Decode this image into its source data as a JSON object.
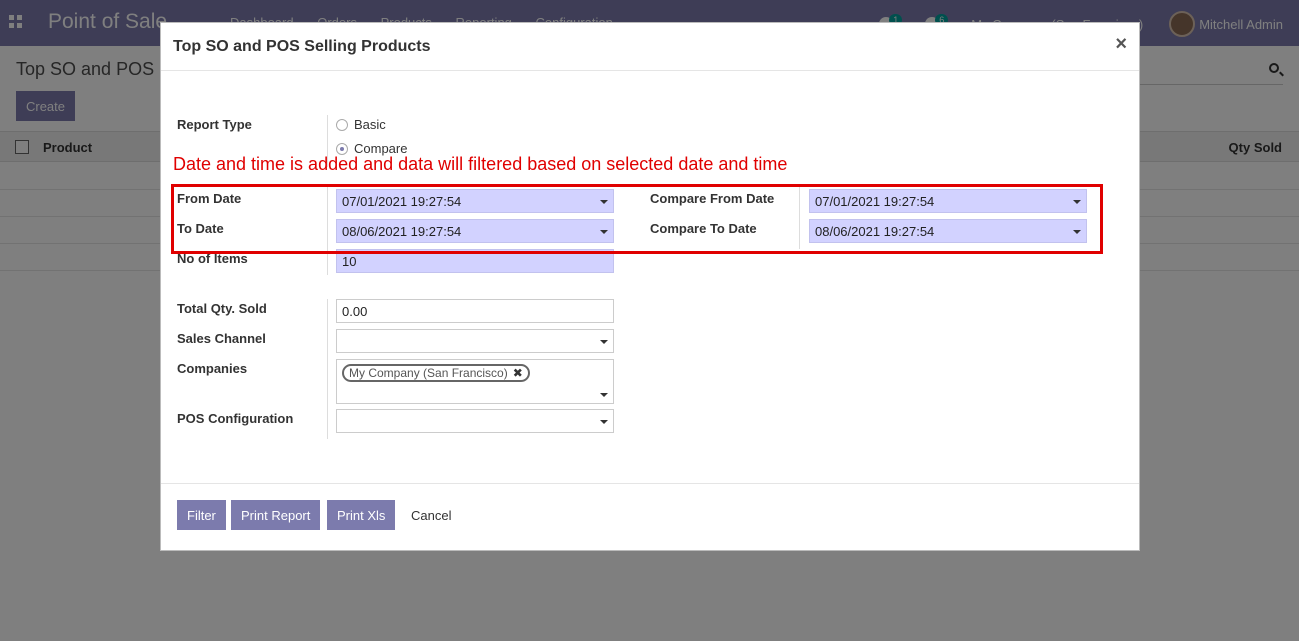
{
  "navbar": {
    "brand": "Point of Sale",
    "menu": [
      "Dashboard",
      "Orders",
      "Products",
      "Reporting",
      "Configuration"
    ],
    "activity_count": "1",
    "messages_count": "6",
    "company": "My Company (San Francisco)",
    "user": "Mitchell Admin"
  },
  "control_panel": {
    "title": "Top SO and POS Selling Products",
    "create_label": "Create"
  },
  "list": {
    "columns": [
      "Product",
      "Qty Sold"
    ]
  },
  "modal": {
    "title": "Top SO and POS Selling Products",
    "close_glyph": "×",
    "annotation": "Date and time is added and data will filtered based on selected date and time",
    "fields": {
      "report_type": {
        "label": "Report Type",
        "options": [
          "Basic",
          "Compare"
        ],
        "selected": "Compare"
      },
      "from_date": {
        "label": "From Date",
        "value": "07/01/2021 19:27:54"
      },
      "to_date": {
        "label": "To Date",
        "value": "08/06/2021 19:27:54"
      },
      "compare_from_date": {
        "label": "Compare From Date",
        "value": "07/01/2021 19:27:54"
      },
      "compare_to_date": {
        "label": "Compare To Date",
        "value": "08/06/2021 19:27:54"
      },
      "no_of_items": {
        "label": "No of Items",
        "value": "10"
      },
      "total_qty_sold": {
        "label": "Total Qty. Sold",
        "value": "0.00"
      },
      "sales_channel": {
        "label": "Sales Channel",
        "value": ""
      },
      "companies": {
        "label": "Companies",
        "tags": [
          "My Company (San Francisco)"
        ]
      },
      "pos_configuration": {
        "label": "POS Configuration",
        "value": ""
      }
    },
    "footer": {
      "filter": "Filter",
      "print_report": "Print Report",
      "print_xls": "Print Xls",
      "cancel": "Cancel"
    }
  },
  "colors": {
    "primary": "#7c7bad",
    "required_field": "#d2d2ff",
    "annotation": "#e00000",
    "badge": "#00a09d"
  }
}
